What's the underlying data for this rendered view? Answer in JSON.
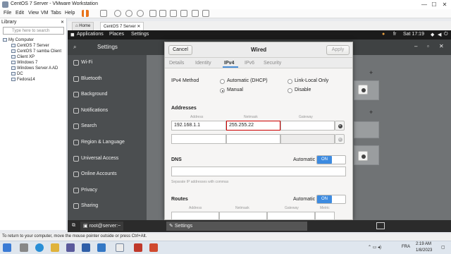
{
  "window": {
    "title": "CentOS 7 Server - VMware Workstation",
    "minimize": "—",
    "maximize": "☐",
    "close": "✕"
  },
  "menu": {
    "items": [
      "File",
      "Edit",
      "View",
      "VM",
      "Tabs",
      "Help"
    ]
  },
  "library": {
    "header": "Library",
    "close": "✕",
    "search_placeholder": "Type here to search",
    "root": "My Computer",
    "vms": [
      "CentOS 7 Server",
      "CentOS 7 samba Client",
      "Client XP",
      "Windows 7",
      "Windows Server A AD",
      "DC",
      "Fedora14"
    ]
  },
  "vm_tabs": [
    {
      "label": "Home",
      "close": ""
    },
    {
      "label": "CentOS 7 Server",
      "close": "✕"
    }
  ],
  "gnome": {
    "applications": "Applications",
    "places": "Places",
    "settings": "Settings",
    "lang": "fr",
    "clock": "Sat 17:19"
  },
  "settings_app": {
    "title": "Settings",
    "sidebar": [
      "Wi-Fi",
      "Bluetooth",
      "Background",
      "Notifications",
      "Search",
      "Region & Language",
      "Universal Access",
      "Online Accounts",
      "Privacy",
      "Sharing"
    ],
    "plus_1": "+",
    "plus_2": "+"
  },
  "dialog": {
    "title": "Wired",
    "cancel": "Cancel",
    "apply": "Apply",
    "tabs": [
      "Details",
      "Identity",
      "IPv4",
      "IPv6",
      "Security"
    ],
    "active_tab": "IPv4",
    "method_label": "IPv4 Method",
    "methods": [
      "Automatic (DHCP)",
      "Manual",
      "Link-Local Only",
      "Disable"
    ],
    "selected_method": "Manual",
    "addresses_label": "Addresses",
    "col_address": "Address",
    "col_netmask": "Netmask",
    "col_gateway": "Gateway",
    "row1": {
      "address": "192.168.1.1",
      "netmask": "255.255.22",
      "gateway": ""
    },
    "row2": {
      "address": "",
      "netmask": "",
      "gateway": ""
    },
    "dns_label": "DNS",
    "automatic": "Automatic",
    "toggle_on": "ON",
    "dns_value": "",
    "dns_hint": "Separate IP addresses with commas",
    "routes_label": "Routes",
    "routes_cols": [
      "Address",
      "Netmask",
      "Gateway",
      "Metric"
    ]
  },
  "guest_bottom": {
    "terminal": "root@server:~",
    "settings": "Settings"
  },
  "statusbar": "To return to your computer, move the mouse pointer outside or press Ctrl+Alt.",
  "taskbar": {
    "time": "2:19 AM",
    "date": "1/8/2023",
    "lang": "FRA"
  }
}
